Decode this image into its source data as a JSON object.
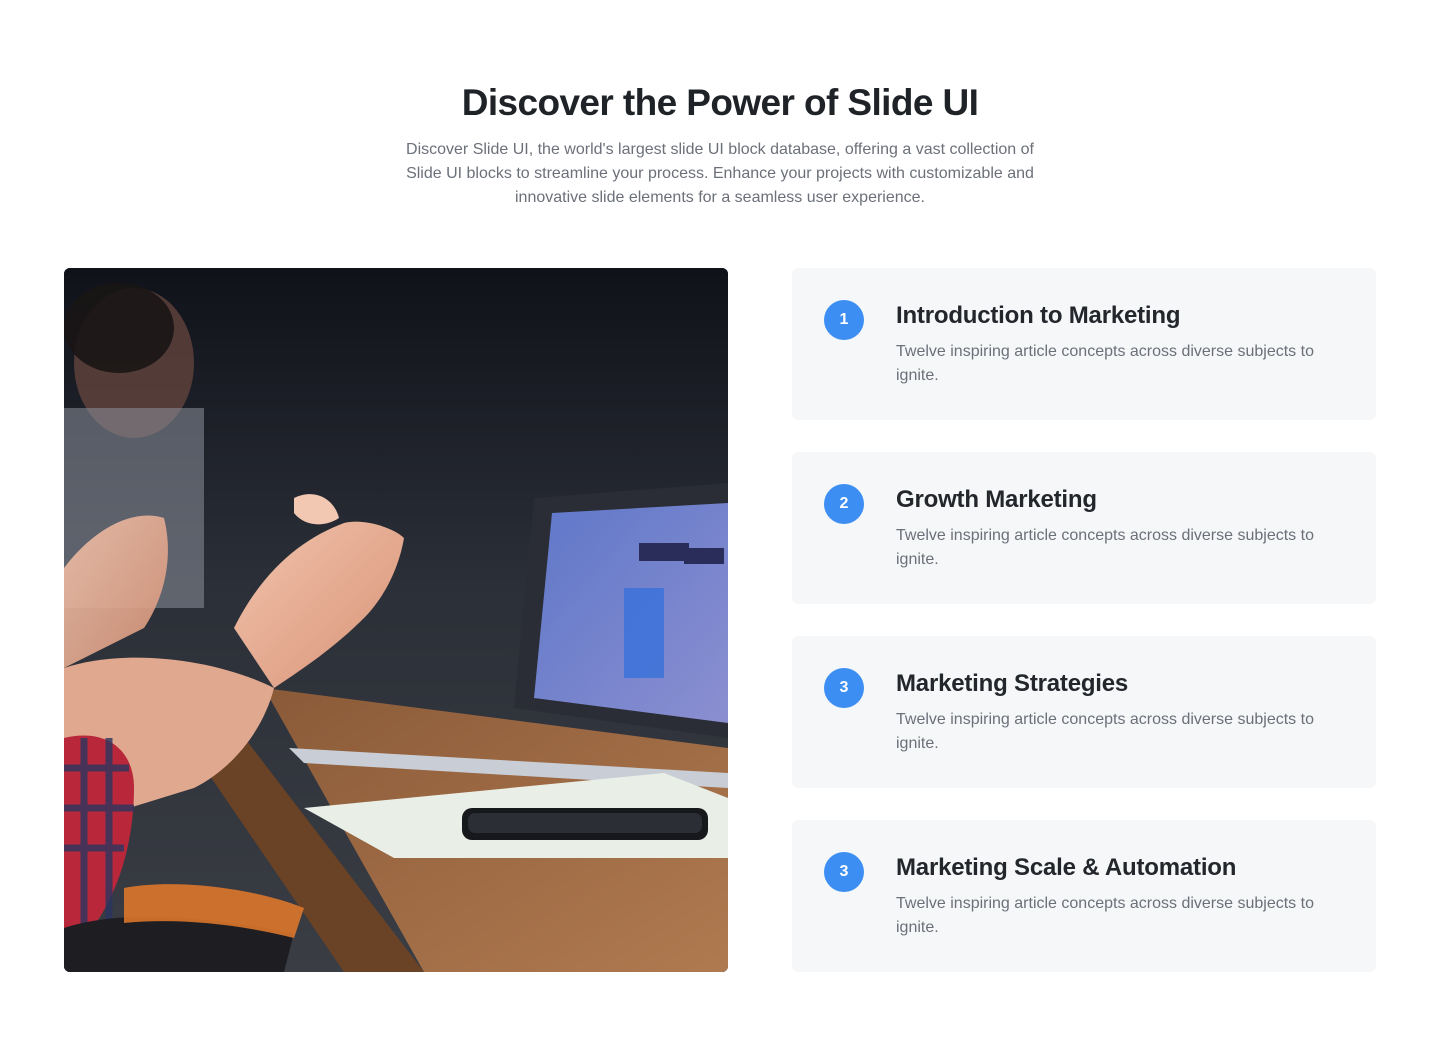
{
  "header": {
    "title": "Discover the Power of Slide UI",
    "subtitle": "Discover Slide UI, the world's largest slide UI block database, offering a vast collection of Slide UI blocks to streamline your process. Enhance your projects with customizable and innovative slide elements for a seamless user experience."
  },
  "media": {
    "subject": "hands-gesturing-at-meeting-table-photo"
  },
  "features": [
    {
      "number": "1",
      "title": "Introduction to Marketing",
      "text": "Twelve inspiring article concepts across diverse subjects to ignite."
    },
    {
      "number": "2",
      "title": "Growth Marketing",
      "text": "Twelve inspiring article concepts across diverse subjects to ignite."
    },
    {
      "number": "3",
      "title": "Marketing Strategies",
      "text": "Twelve inspiring article concepts across diverse subjects to ignite."
    },
    {
      "number": "3",
      "title": "Marketing Scale & Automation",
      "text": "Twelve inspiring article concepts across diverse subjects to ignite."
    }
  ],
  "colors": {
    "accent": "#3d8ef2",
    "card_bg": "#f6f7f9",
    "heading": "#1f2328",
    "body_text": "#6b7079"
  }
}
